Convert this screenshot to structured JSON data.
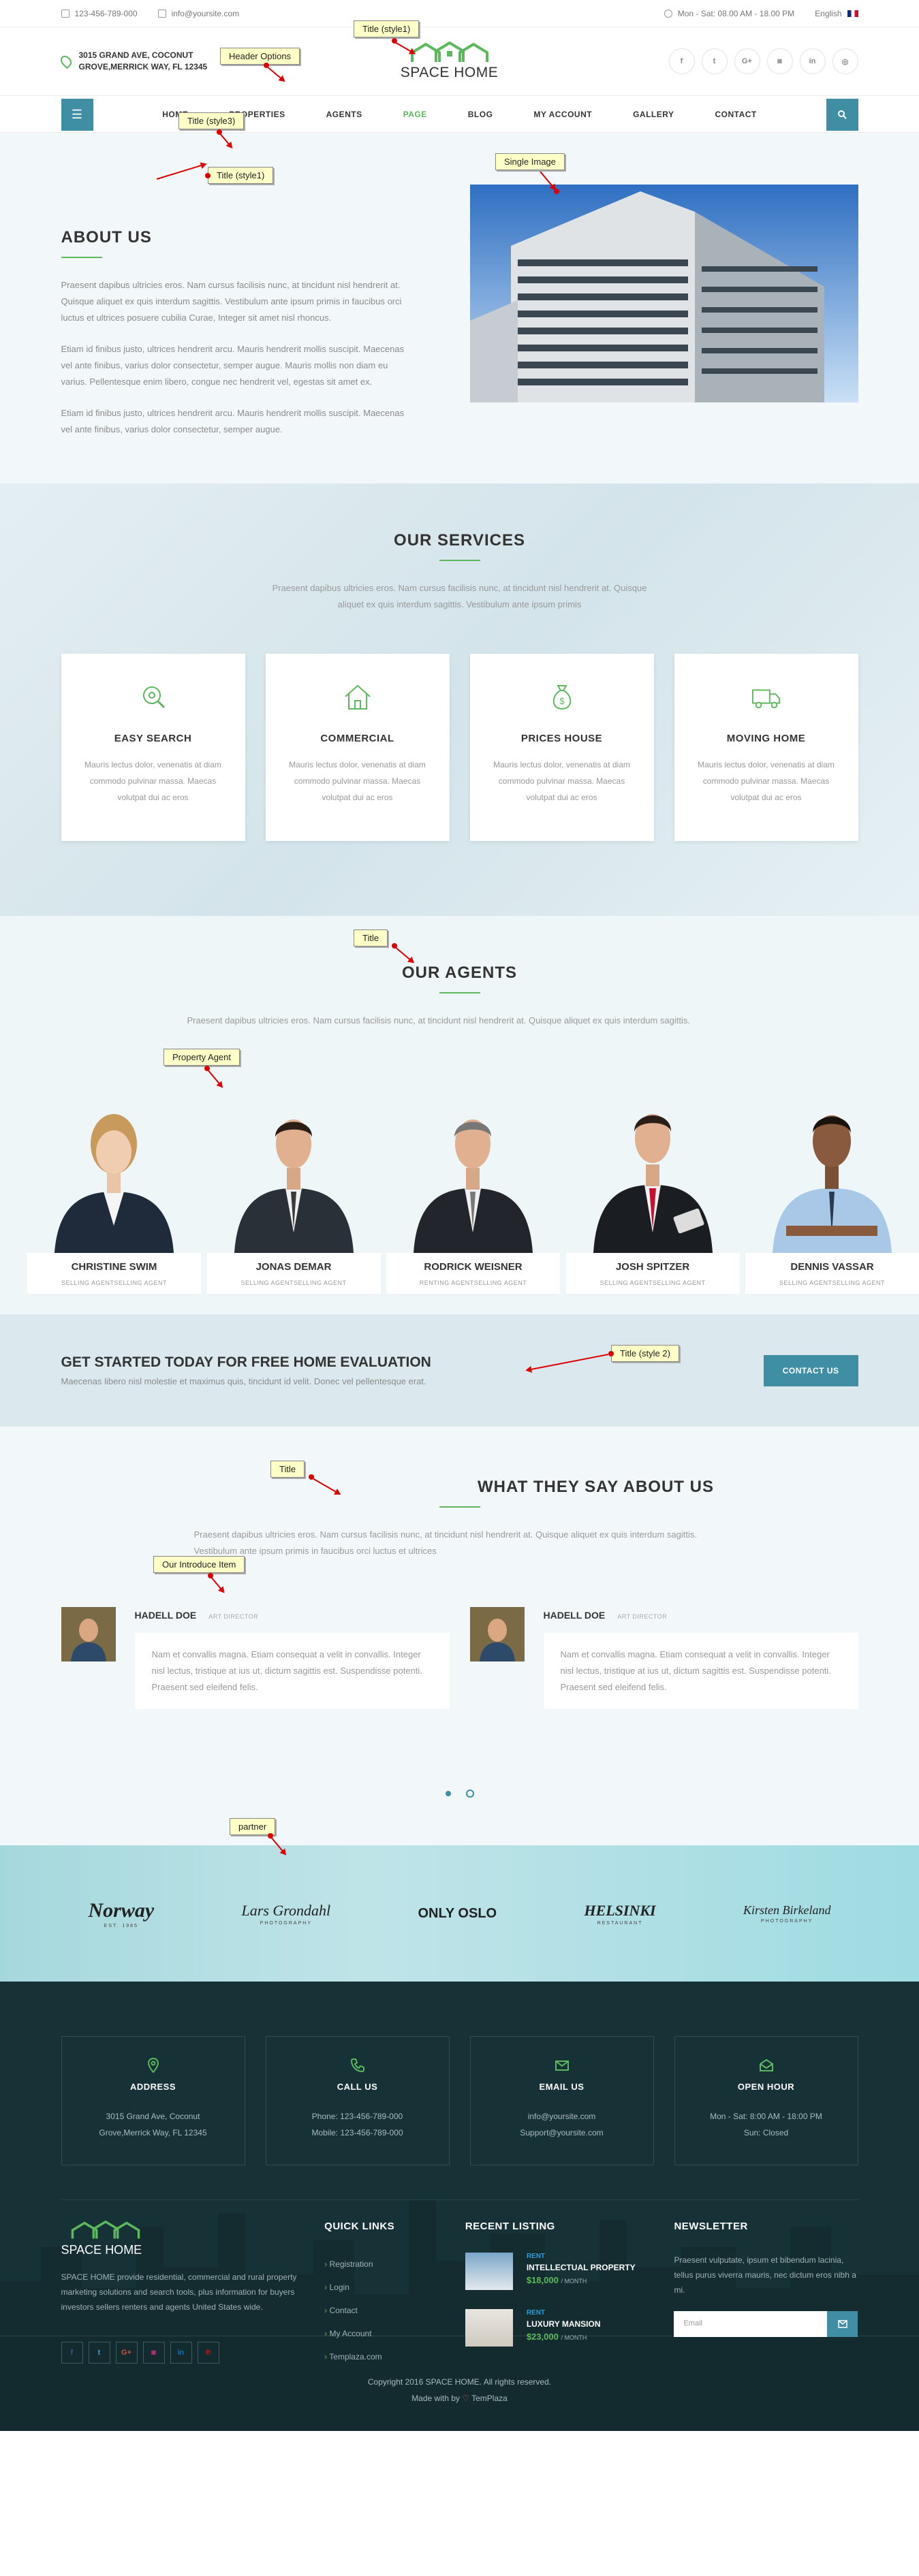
{
  "topbar": {
    "phone": "123-456-789-000",
    "email": "info@yoursite.com",
    "hours": "Mon - Sat: 08.00 AM - 18.00 PM",
    "language": "English"
  },
  "header": {
    "address_line1": "3015 GRAND AVE, COCONUT",
    "address_line2": "GROVE,MERRICK WAY, FL 12345",
    "logo_text": "SPACE HOME",
    "socials": [
      "f",
      "t",
      "G+",
      "in-sq",
      "in",
      "o"
    ],
    "annotation": "Header Options"
  },
  "nav": {
    "items": [
      "HOME",
      "PROPERTIES",
      "AGENTS",
      "PAGE",
      "BLOG",
      "MY ACCOUNT",
      "GALLERY",
      "CONTACT"
    ],
    "active_index": 3
  },
  "about": {
    "title": "ABOUT US",
    "paragraphs": [
      "Praesent dapibus ultricies eros. Nam cursus facilisis nunc, at tincidunt nisl hendrerit at. Quisque aliquet ex quis interdum sagittis. Vestibulum ante ipsum primis in faucibus orci luctus et ultrices posuere cubilia Curae, Integer sit amet nisl rhoncus.",
      "Etiam id finibus justo, ultrices hendrerit arcu. Mauris hendrerit mollis suscipit. Maecenas vel ante finibus, varius dolor consectetur, semper augue. Mauris mollis non diam eu varius. Pellentesque enim libero, congue nec hendrerit vel, egestas sit amet ex.",
      "Etiam id finibus justo, ultrices hendrerit arcu. Mauris hendrerit mollis suscipit. Maecenas vel ante finibus, varius dolor consectetur, semper augue."
    ],
    "annotation_title": "Title (style1)",
    "annotation_image": "Single Image"
  },
  "services": {
    "title": "OUR SERVICES",
    "lead": "Praesent dapibus ultricies eros. Nam cursus facilisis nunc, at tincidunt nisl hendrerit at. Quisque aliquet ex quis interdum sagittis. Vestibulum ante ipsum primis",
    "annotation_title": "Title (style1)",
    "annotation_cards": "Title (style3)",
    "items": [
      {
        "title": "EASY SEARCH",
        "text": "Mauris lectus dolor, venenatis at diam commodo pulvinar massa. Maecas volutpat dui ac eros",
        "icon": "search-icon"
      },
      {
        "title": "COMMERCIAL",
        "text": "Mauris lectus dolor, venenatis at diam commodo pulvinar massa. Maecas volutpat dui ac eros",
        "icon": "home-icon"
      },
      {
        "title": "PRICES HOUSE",
        "text": "Mauris lectus dolor, venenatis at diam commodo pulvinar massa. Maecas volutpat dui ac eros",
        "icon": "money-bag-icon"
      },
      {
        "title": "MOVING HOME",
        "text": "Mauris lectus dolor, venenatis at diam commodo pulvinar massa. Maecas volutpat dui ac eros",
        "icon": "truck-icon"
      }
    ]
  },
  "agents": {
    "title": "OUR AGENTS",
    "lead": "Praesent dapibus ultricies eros. Nam cursus facilisis nunc, at tincidunt nisl hendrerit at. Quisque aliquet ex quis interdum sagittis.",
    "annotation_title": "Title",
    "annotation_agent": "Property Agent",
    "items": [
      {
        "name": "CHRISTINE SWIM",
        "role": "SELLING AGENTSELLING AGENT"
      },
      {
        "name": "JONAS DEMAR",
        "role": "SELLING AGENTSELLING AGENT"
      },
      {
        "name": "RODRICK WEISNER",
        "role": "RENTING AGENTSELLING AGENT"
      },
      {
        "name": "JOSH SPITZER",
        "role": "SELLING AGENTSELLING AGENT"
      },
      {
        "name": "DENNIS VASSAR",
        "role": "SELLING AGENTSELLING AGENT"
      }
    ]
  },
  "cta": {
    "title": "GET STARTED TODAY FOR FREE HOME EVALUATION",
    "text": "Maecenas libero nisl molestie et maximus quis, tincidunt id velit. Donec vel pellentesque erat.",
    "button": "CONTACT US",
    "annotation": "Title (style 2)"
  },
  "testimonials": {
    "title": "WHAT THEY SAY ABOUT US",
    "lead": "Praesent dapibus ultricies eros. Nam cursus facilisis nunc, at tincidunt nisl hendrerit at. Quisque aliquet ex quis interdum sagittis. Vestibulum ante ipsum primis in faucibus orci luctus et ultrices",
    "annotation_title": "Title",
    "annotation_item": "Our Introduce Item",
    "items": [
      {
        "name": "HADELL DOE",
        "role": "ART DIRECTOR",
        "quote": "Nam et convallis magna. Etiam consequat a velit in convallis. Integer nisl lectus, tristique at ius ut, dictum sagittis est. Suspendisse potenti. Praesent sed eleifend felis."
      },
      {
        "name": "HADELL DOE",
        "role": "ART DIRECTOR",
        "quote": "Nam et convallis magna. Etiam consequat a velit in convallis. Integer nisl lectus, tristique at ius ut, dictum sagittis est. Suspendisse potenti. Praesent sed eleifend felis."
      }
    ]
  },
  "partners": {
    "annotation": "partner",
    "items": [
      {
        "name": "Norway",
        "sub": "EST. 1985"
      },
      {
        "name": "Lars Grondahl",
        "sub": "PHOTOGRAPHY"
      },
      {
        "name": "ONLY OSLO",
        "sub": ""
      },
      {
        "name": "HELSINKI",
        "sub": "RESTAURANT"
      },
      {
        "name": "Kirsten Birkeland",
        "sub": "PHOTOGRAPHY"
      }
    ]
  },
  "footer": {
    "boxes": [
      {
        "title": "ADDRESS",
        "line1": "3015 Grand Ave, Coconut",
        "line2": "Grove,Merrick Way, FL 12345",
        "icon": "pin-icon"
      },
      {
        "title": "CALL US",
        "line1": "Phone: 123-456-789-000",
        "line2": "Mobile: 123-456-789-000",
        "icon": "phone-icon"
      },
      {
        "title": "EMAIL US",
        "line1": "info@yoursite.com",
        "line2": "Support@yoursite.com",
        "icon": "mail-icon"
      },
      {
        "title": "OPEN HOUR",
        "line1": "Mon - Sat: 8:00 AM - 18:00 PM",
        "line2": "Sun: Closed",
        "icon": "clock-icon"
      }
    ],
    "about_logo": "SPACE HOME",
    "about_text": "SPACE HOME provide residential, commercial and rural property marketing solutions and search tools, plus information for buyers investors sellers renters and agents United States wide.",
    "quick_links_title": "QUICK LINKS",
    "quick_links": [
      "Registration",
      "Login",
      "Contact",
      "My Account",
      "Templaza.com"
    ],
    "recent_title": "RECENT LISTING",
    "recent": [
      {
        "tag": "RENT",
        "title": "INTELLECTUAL PROPERTY",
        "price": "$18,000",
        "per": "/ MONTH"
      },
      {
        "tag": "RENT",
        "title": "LUXURY MANSION",
        "price": "$23,000",
        "per": "/ MONTH"
      }
    ],
    "newsletter_title": "NEWSLETTER",
    "newsletter_text": "Praesent vulputate, ipsum et bibendum lacinia, tellus purus viverra mauris, nec dictum eros nibh a mi.",
    "newsletter_placeholder": "Email",
    "socials": [
      "f",
      "t",
      "G+",
      "in-sq",
      "in",
      "p"
    ],
    "copyright": "Copyright 2016 SPACE HOME. All rights reserved.",
    "made_with": "Made with by",
    "made_by": "TemPlaza"
  }
}
